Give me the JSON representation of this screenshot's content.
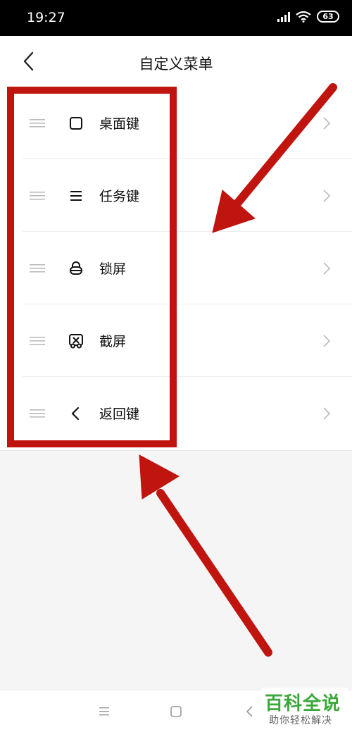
{
  "status_bar": {
    "time": "19:27",
    "battery": "63"
  },
  "header": {
    "title": "自定义菜单"
  },
  "menu_items": [
    {
      "label": "桌面键",
      "icon": "square-icon"
    },
    {
      "label": "任务键",
      "icon": "menu-lines-icon"
    },
    {
      "label": "锁屏",
      "icon": "lock-icon"
    },
    {
      "label": "截屏",
      "icon": "screenshot-icon"
    },
    {
      "label": "返回键",
      "icon": "back-chevron-icon"
    }
  ],
  "annotation": {
    "highlight_color": "#c0140f"
  },
  "watermark": {
    "title": "百科全说",
    "subtitle": "助你轻松解决"
  }
}
